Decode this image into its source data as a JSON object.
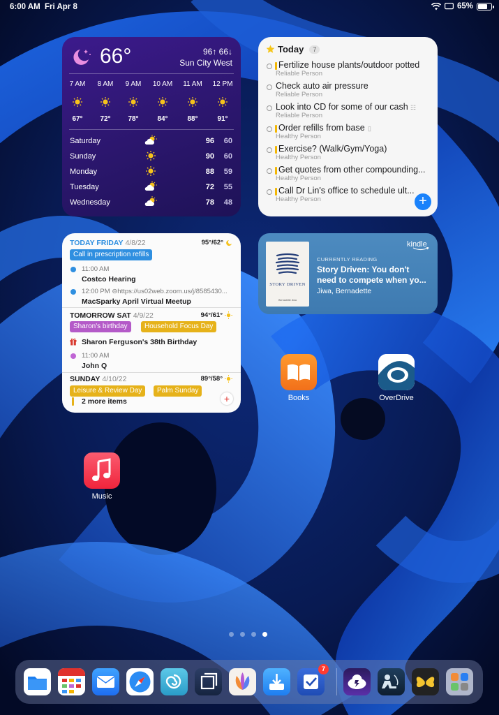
{
  "status_bar": {
    "time": "6:00 AM",
    "date": "Fri Apr 8",
    "battery": "65%",
    "battery_level": 0.65
  },
  "weather": {
    "current_temp": "66°",
    "hi_lo": "96↑ 66↓",
    "location": "Sun City West",
    "hourly": [
      {
        "hour": "7 AM",
        "temp": "67°"
      },
      {
        "hour": "8 AM",
        "temp": "72°"
      },
      {
        "hour": "9 AM",
        "temp": "78°"
      },
      {
        "hour": "10 AM",
        "temp": "84°"
      },
      {
        "hour": "11 AM",
        "temp": "88°"
      },
      {
        "hour": "12 PM",
        "temp": "91°"
      }
    ],
    "daily": [
      {
        "day": "Saturday",
        "icon": "partly-cloudy-icon",
        "hi": "96",
        "lo": "60"
      },
      {
        "day": "Sunday",
        "icon": "sun-icon",
        "hi": "90",
        "lo": "60"
      },
      {
        "day": "Monday",
        "icon": "sun-icon",
        "hi": "88",
        "lo": "59"
      },
      {
        "day": "Tuesday",
        "icon": "partly-cloudy-icon",
        "hi": "72",
        "lo": "55"
      },
      {
        "day": "Wednesday",
        "icon": "partly-cloudy-icon",
        "hi": "78",
        "lo": "48"
      }
    ]
  },
  "reminders": {
    "title": "Today",
    "count": "7",
    "items": [
      {
        "title": "Fertilize house plants/outdoor potted",
        "list": "Reliable Person",
        "flagged": true
      },
      {
        "title": "Check auto air pressure",
        "list": "Reliable Person",
        "flagged": false
      },
      {
        "title": "Look into CD for some of our cash",
        "list": "Reliable Person",
        "flagged": false
      },
      {
        "title": "Order refills from base",
        "list": "Healthy Person",
        "flagged": true
      },
      {
        "title": "Exercise? (Walk/Gym/Yoga)",
        "list": "Healthy Person",
        "flagged": true
      },
      {
        "title": "Get quotes from other compounding...",
        "list": "Healthy Person",
        "flagged": true
      },
      {
        "title": "Call Dr Lin's office to schedule ult...",
        "list": "Healthy Person",
        "flagged": true
      }
    ]
  },
  "calendar": {
    "today": {
      "label": "TODAY FRIDAY",
      "date": "4/8/22",
      "weather": "95°/62°",
      "chip": "Call in prescription refills",
      "events": [
        {
          "time": "11:00 AM",
          "name": "Costco Hearing",
          "color": "#2f8fe0"
        },
        {
          "time": "12:00 PM",
          "url": "https://us02web.zoom.us/j/8585430...",
          "name": "MacSparky April Virtual Meetup",
          "color": "#2f8fe0"
        }
      ]
    },
    "tomorrow": {
      "label": "TOMORROW SAT",
      "date": "4/9/22",
      "weather": "94°/61°",
      "chips": [
        "Sharon's birthday",
        "Household Focus Day"
      ],
      "events": [
        {
          "name": "Sharon Ferguson's 38th Birthday"
        },
        {
          "time": "11:00 AM",
          "name": "John Q",
          "color": "#c065d4"
        }
      ]
    },
    "sunday": {
      "label": "SUNDAY",
      "date": "4/10/22",
      "weather": "89°/58°",
      "chips": [
        "Leisure & Review Day",
        "Palm Sunday"
      ],
      "more": "2 more items"
    }
  },
  "kindle": {
    "brand": "kindle",
    "section": "CURRENTLY READING",
    "title_line1": "Story Driven: You don't",
    "title_line2": "need to compete when yo...",
    "author": "Jiwa, Bernadette",
    "cover_title": "STORY DRIVEN",
    "cover_author": "Bernadette Jiwa"
  },
  "apps": {
    "books": "Books",
    "overdrive": "OverDrive",
    "music": "Music"
  },
  "dock": {
    "badge": "7",
    "items": [
      "Files",
      "Fantastical",
      "Mail",
      "Safari",
      "Mastodon",
      "Multi",
      "Craft",
      "Transloader",
      "OmniFocus",
      "Cloud",
      "Kindle",
      "Tes",
      "App Library"
    ]
  },
  "colors": {
    "accent_blue": "#1a82fb",
    "weather_bg": "#2e1772",
    "kindle_bg": "#4682b8",
    "flag_yellow": "#f2b705"
  }
}
